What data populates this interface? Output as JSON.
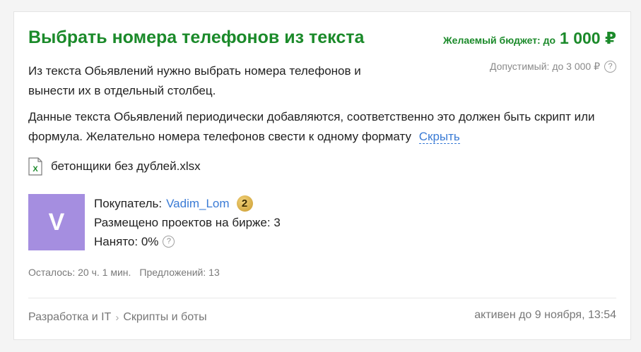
{
  "project": {
    "title": "Выбрать номера телефонов из текста",
    "budget_label": "Желаемый бюджет: до",
    "budget_value": "1 000 ₽",
    "allowed_label": "Допустимый: до 3 000 ₽",
    "description_1": "Из текста Обьявлений нужно выбрать номера телефонов и вынести их в отдельный столбец.",
    "description_2": "Данные текста Обьявлений периодически добавляются, соответственно это должен быть скрипт или формула. Желательно номера телефонов свести к одному формату",
    "hide_link": "Скрыть",
    "attachment": {
      "name": "бетонщики без дублей.xlsx",
      "icon": "excel-file-icon"
    }
  },
  "buyer": {
    "avatar_letter": "V",
    "avatar_color": "#a58ee0",
    "label": "Покупатель:",
    "name": "Vadim_Lom",
    "level": "2",
    "projects_text": "Размещено проектов на бирже: 3",
    "hired_text": "Нанято: 0%"
  },
  "meta": {
    "time_left": "Осталось: 20 ч. 1 мин.",
    "offers": "Предложений: 13"
  },
  "footer": {
    "category": "Разработка и IT",
    "subcategory": "Скрипты и боты",
    "activity": "активен до 9 ноября, 13:54"
  },
  "colors": {
    "title": "#1b8a2a",
    "link": "#3a7bd5"
  }
}
